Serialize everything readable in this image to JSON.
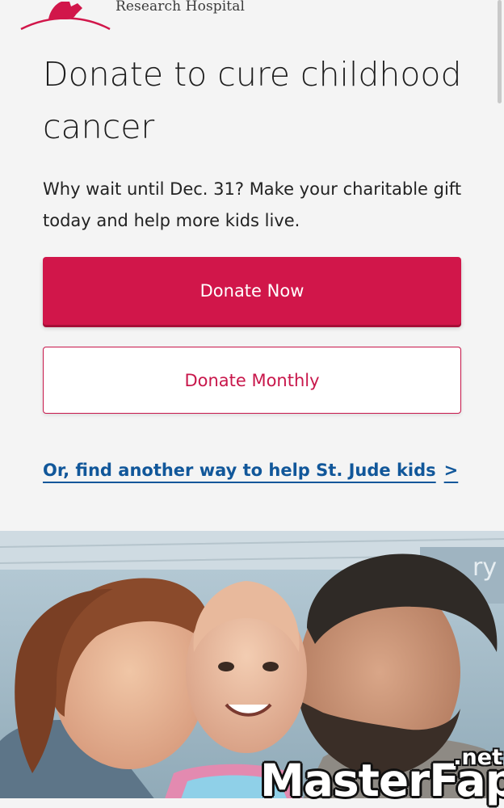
{
  "header": {
    "logo_text": "Research Hospital",
    "logo_icon": "st-jude-child-figure-logo",
    "brand_color": "#d1164a"
  },
  "hero": {
    "headline": "Donate to cure childhood cancer",
    "subtext": "Why wait until Dec. 31? Make your charitable gift today and help more kids live."
  },
  "actions": {
    "donate_now_label": "Donate Now",
    "donate_monthly_label": "Donate Monthly",
    "help_link_label": "Or, find another way to help St. Jude kids",
    "help_link_chevron": ">"
  },
  "photo": {
    "description_icon": "family-photo",
    "sign_text": "ry"
  },
  "watermark": {
    "text": "MasterFap",
    "suffix": ".net"
  },
  "colors": {
    "primary": "#d1164a",
    "link": "#11579a",
    "background": "#f4f4f4"
  }
}
